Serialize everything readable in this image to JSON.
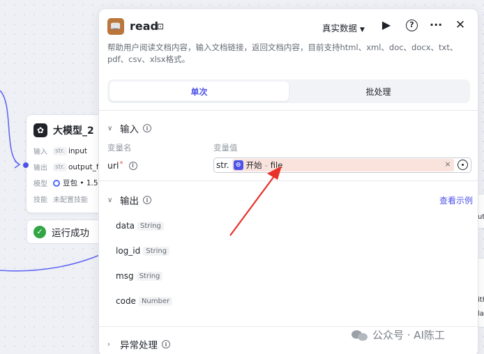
{
  "node": {
    "title": "大模型_2",
    "rows": [
      {
        "key": "输入",
        "type": "str.",
        "value": "input"
      },
      {
        "key": "输出",
        "type": "str.",
        "value": "output_fi"
      },
      {
        "key": "模型",
        "type": "",
        "value": "豆包 • 1.5"
      },
      {
        "key": "技能",
        "type": "",
        "value": "未配置技能"
      }
    ]
  },
  "status": {
    "label": "运行成功"
  },
  "panel": {
    "title": "read",
    "mode_label": "真实数据",
    "description": "帮助用户阅读文档内容，输入文档链接，返回文档内容，目前支持html、xml、doc、docx、txt、pdf、csv、xlsx格式。",
    "tabs": [
      {
        "label": "单次",
        "active": true
      },
      {
        "label": "批处理",
        "active": false
      }
    ],
    "input": {
      "section_label": "输入",
      "col_name_label": "变量名",
      "col_value_label": "变量值",
      "param": {
        "name": "url",
        "required_mark": "*",
        "type_label": "str.",
        "ref_node": "开始",
        "ref_sep": "-",
        "ref_field": "file"
      }
    },
    "output": {
      "section_label": "输出",
      "see_example": "查看示例",
      "fields": [
        {
          "name": "data",
          "type": "String"
        },
        {
          "name": "log_id",
          "type": "String"
        },
        {
          "name": "msg",
          "type": "String"
        },
        {
          "name": "code",
          "type": "Number"
        }
      ]
    },
    "error_section_label": "异常处理"
  },
  "watermark": {
    "text": "公众号 · AI陈工"
  },
  "peek": {
    "top": "ut",
    "bottom_a": "ith",
    "bottom_b": "la"
  },
  "colors": {
    "accent": "#4d53e8",
    "arrow": "#e8312a",
    "success": "#32a645",
    "ref_chip_bg": "#f9e3dc"
  }
}
